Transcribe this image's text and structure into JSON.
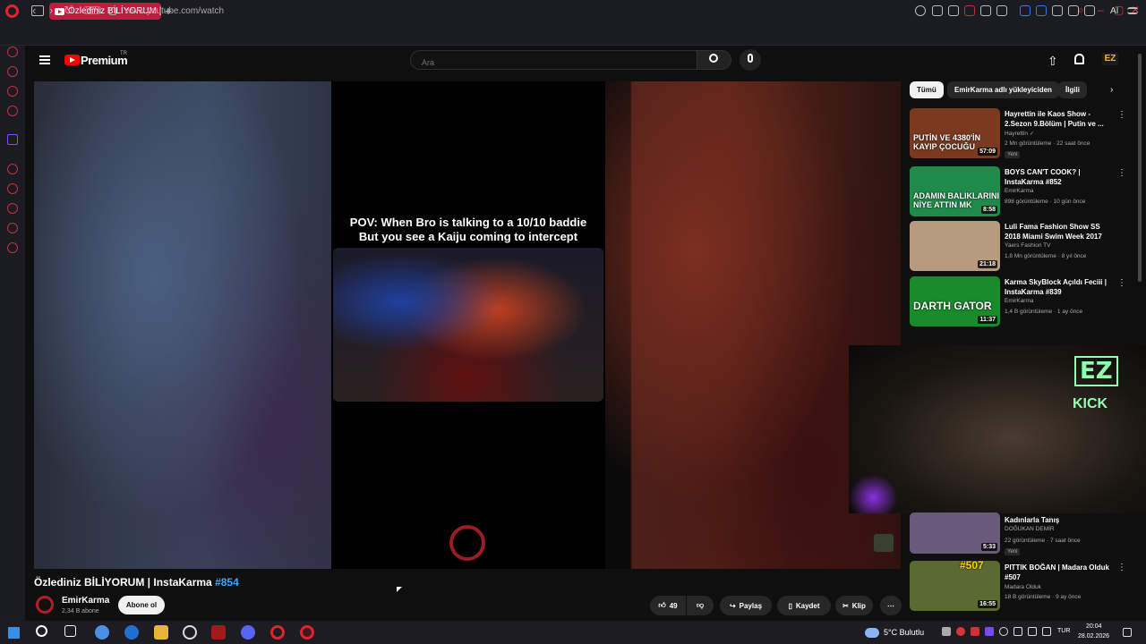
{
  "browser": {
    "tab_title": "Özlediniz BİLİYORUM |",
    "vpn": "VPN",
    "url": "www.youtube.com/watch",
    "ai_label": "AI"
  },
  "youtube": {
    "brand": "Premium",
    "region": "TR",
    "search_placeholder": "Ara",
    "avatar_initials": "EZ"
  },
  "video": {
    "caption_line1": "POV: When Bro is talking to a 10/10 baddie",
    "caption_line2": "But you see a Kaiju coming to intercept",
    "title": "Özlediniz BİLİYORUM | InstaKarma",
    "hashtag": "#854",
    "channel": "EmirKarma",
    "subscribers": "2,34 B abone",
    "subscribe_label": "Abone ol",
    "likes": "49",
    "share_label": "Paylaş",
    "save_label": "Kaydet",
    "clip_label": "Klip"
  },
  "overlay": {
    "logo_text": "EZ",
    "kick_text": "KICK"
  },
  "chips": [
    "Tümü",
    "EmirKarma adlı yükleyiciden",
    "İlgili"
  ],
  "recommendations": [
    {
      "title": "Hayrettin ile Kaos Show - 2.Sezon 9.Bölüm | Putin ve ...",
      "channel": "Hayrettin ✓",
      "meta": "2 Mn görüntüleme · 22 saat önce",
      "badge": "Yeni",
      "duration": "57:09",
      "thumb_text": "PUTİN VE 4380'İN KAYIP ÇOCUĞU",
      "color": "#7a3a20"
    },
    {
      "title": "BOYS CAN'T COOK? | InstaKarma #852",
      "channel": "EmirKarma",
      "meta": "898 görüntüleme · 10 gün önce",
      "badge": "",
      "duration": "8:58",
      "thumb_text": "ADAMIN BALIKLARINI NİYE ATTIN MK",
      "color": "#1f8a4a"
    },
    {
      "title": "Luli Fama Fashion Show SS 2018 Miami Swim Week 2017",
      "channel": "Yaers Fashion TV",
      "meta": "1,8 Mn görüntüleme · 8 yıl önce",
      "badge": "",
      "duration": "21:18",
      "thumb_text": "",
      "color": "#b89a80"
    },
    {
      "title": "Karma SkyBlock Açıldı Feciii | InstaKarma #839",
      "channel": "EmirKarma",
      "meta": "1,4 B görüntüleme · 1 ay önce",
      "badge": "",
      "duration": "11:37",
      "thumb_text": "DARTH GATOR",
      "color": "#1a8a2a"
    },
    {
      "title": "Kadınlarla Tanış",
      "channel": "DOĞUKAN DEMİR",
      "meta": "22 görüntüleme · 7 saat önce",
      "badge": "Yeni",
      "duration": "5:33",
      "thumb_text": "",
      "color": "#6a5a7a"
    },
    {
      "title": "PITTIK BOĞAN | Madara Olduk #507",
      "channel": "Madara Olduk",
      "meta": "18 B görüntüleme · 9 ay önce",
      "badge": "",
      "duration": "16:55",
      "thumb_text": "#507",
      "color": "#5a6a30"
    }
  ],
  "taskbar": {
    "weather": "5°C  Bulutlu",
    "lang": "TUR",
    "time": "20:04",
    "date": "28.02.2026"
  },
  "colors": {
    "accent": "#c01b3f",
    "link": "#3ea6ff",
    "kick": "#8fffaf"
  }
}
